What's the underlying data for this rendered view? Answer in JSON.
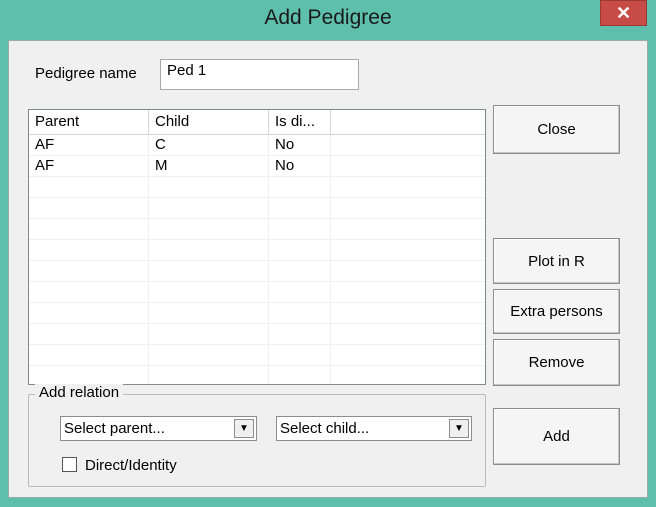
{
  "window": {
    "title": "Add Pedigree",
    "close_glyph": "✕"
  },
  "pedigree": {
    "label": "Pedigree name",
    "value": "Ped 1"
  },
  "table": {
    "columns": [
      "Parent",
      "Child",
      "Is di...",
      ""
    ],
    "rows": [
      [
        "AF",
        "C",
        "No",
        ""
      ],
      [
        "AF",
        "M",
        "No",
        ""
      ]
    ]
  },
  "buttons": {
    "close": "Close",
    "plot": "Plot in R",
    "extra": "Extra persons",
    "remove": "Remove",
    "add": "Add"
  },
  "add_relation": {
    "legend": "Add relation",
    "parent_select": "Select parent...",
    "child_select": "Select child...",
    "checkbox_label": "Direct/Identity",
    "checkbox_checked": false
  }
}
